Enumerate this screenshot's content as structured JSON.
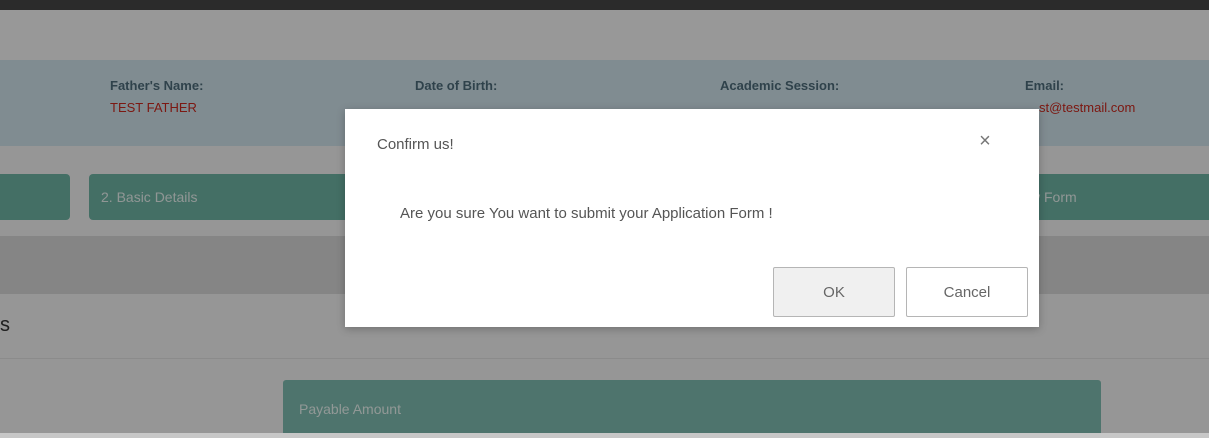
{
  "info": {
    "fathers_name_label": "Father's Name:",
    "fathers_name_value": "TEST FATHER",
    "dob_label": "Date of Birth:",
    "session_label": "Academic Session:",
    "email_label": "Email:",
    "email_value": "st@testmail.com"
  },
  "steps": {
    "basic_details": "2. Basic Details",
    "view_form": "w Form"
  },
  "section": {
    "title_fragment": "s"
  },
  "payable": {
    "label": "Payable Amount"
  },
  "dialog": {
    "title": "Confirm us!",
    "close_glyph": "×",
    "message": "Are you sure You want to submit your Application Form !",
    "ok_label": "OK",
    "cancel_label": "Cancel"
  },
  "colors": {
    "accent_teal": "#6fb3a3",
    "value_red": "#c8281e",
    "label_blue": "#4d6b7a"
  }
}
